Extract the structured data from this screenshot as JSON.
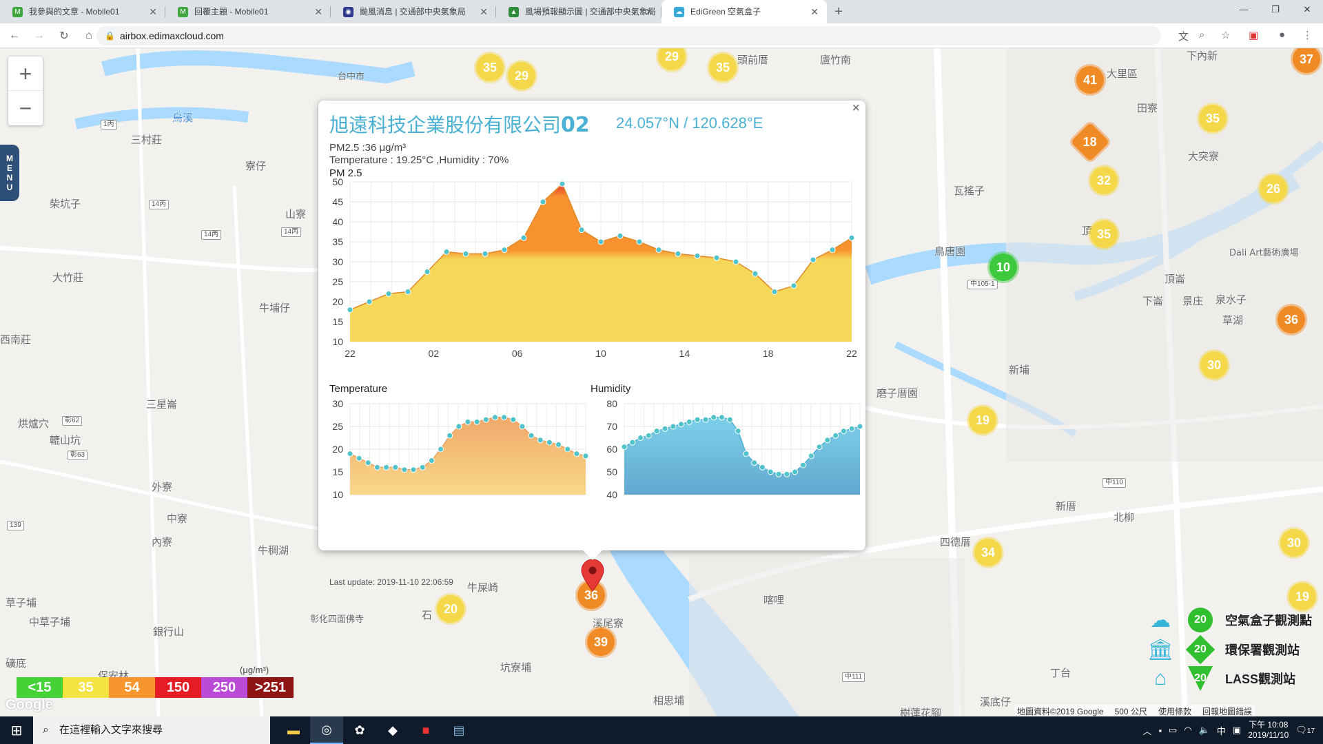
{
  "browser": {
    "tabs": [
      {
        "label": "我參與的文章 - Mobile01",
        "icon": "mobile01-icon",
        "active": false
      },
      {
        "label": "回覆主題 - Mobile01",
        "icon": "mobile01-icon",
        "active": false
      },
      {
        "label": "颱風消息 | 交通部中央氣象局",
        "icon": "cwb-icon",
        "active": false
      },
      {
        "label": "風場預報顯示圖 | 交通部中央氣象局",
        "icon": "cwb-map-icon",
        "active": false
      },
      {
        "label": "EdiGreen 空氣盒子",
        "icon": "edigreen-icon",
        "active": true
      }
    ],
    "url": "airbox.edimaxcloud.com"
  },
  "map": {
    "labels": [
      "三村莊",
      "寮仔",
      "柴坑子",
      "山寮",
      "大竹莊",
      "牛埔仔",
      "西南莊",
      "三星崙",
      "烘爐穴",
      "轆山坑",
      "外寮",
      "中寮",
      "內寮",
      "牛稠湖",
      "草子埔",
      "中草子埔",
      "銀行山",
      "礦底",
      "保安林",
      "牛屎崎",
      "石",
      "坑寮埔",
      "溪尾寮",
      "相思埔",
      "喀哩",
      "瓦搖子",
      "鳥唐園",
      "頂厝子",
      "頂崙",
      "下崙",
      "景庄",
      "泉水子",
      "草湖",
      "新埔",
      "磨子厝園",
      "新厝",
      "北柳",
      "四德厝",
      "丁台",
      "溪底仔",
      "樹蓮花腳",
      "大里區",
      "大突寮",
      "田寮",
      "頭前厝",
      "廬竹南",
      "下內新",
      "台中市",
      "烏溪",
      "彰化四面佛寺",
      "Dali Art藝術廣場"
    ],
    "markers": [
      {
        "value": "35",
        "color": "yellow"
      },
      {
        "value": "29",
        "color": "yellow"
      },
      {
        "value": "29",
        "color": "yellow"
      },
      {
        "value": "35",
        "color": "yellow"
      },
      {
        "value": "41",
        "color": "orange"
      },
      {
        "value": "37",
        "color": "orange"
      },
      {
        "value": "18",
        "color": "orange"
      },
      {
        "value": "35",
        "color": "yellow"
      },
      {
        "value": "32",
        "color": "yellow"
      },
      {
        "value": "26",
        "color": "yellow"
      },
      {
        "value": "35",
        "color": "yellow"
      },
      {
        "value": "10",
        "color": "green"
      },
      {
        "value": "36",
        "color": "orange"
      },
      {
        "value": "30",
        "color": "yellow"
      },
      {
        "value": "19",
        "color": "yellow"
      },
      {
        "value": "34",
        "color": "yellow"
      },
      {
        "value": "30",
        "color": "yellow"
      },
      {
        "value": "19",
        "color": "yellow"
      },
      {
        "value": "20",
        "color": "yellow"
      },
      {
        "value": "36",
        "color": "orange"
      },
      {
        "value": "39",
        "color": "orange"
      }
    ]
  },
  "popup": {
    "title_prefix": "旭遠科技企業股份有限公司",
    "title_num": "02",
    "coords": "24.057°N / 120.628°E",
    "pm25_line": "PM2.5 :36 μg/m³",
    "temp_hum_line": "Temperature : 19.25°C ,Humidity : 70%",
    "pm_chart_title": "PM 2.5",
    "temp_chart_title": "Temperature",
    "hum_chart_title": "Humidity",
    "last_update": "Last update: 2019-11-10 22:06:59",
    "close": "×"
  },
  "chart_data": [
    {
      "type": "area",
      "title": "PM 2.5",
      "x_ticks": [
        "22",
        "02",
        "06",
        "10",
        "14",
        "18",
        "22"
      ],
      "ylim": [
        10,
        50
      ],
      "y_ticks": [
        10,
        15,
        20,
        25,
        30,
        35,
        40,
        45,
        50
      ],
      "values": [
        18,
        20,
        22,
        22.5,
        27.5,
        32.5,
        32,
        32,
        33,
        36,
        45,
        49.5,
        38,
        35,
        36.5,
        35,
        33,
        32,
        31.5,
        31,
        30,
        27,
        22.5,
        24,
        30.5,
        33,
        36
      ],
      "threshold_colors": {
        "low": "#f5d75a",
        "mid": "#f7922e",
        "high": "#e03030"
      }
    },
    {
      "type": "area",
      "title": "Temperature",
      "ylim": [
        10,
        30
      ],
      "y_ticks": [
        10,
        15,
        20,
        25,
        30
      ],
      "values": [
        19,
        18,
        17,
        16,
        16,
        16,
        15.5,
        15.5,
        16,
        17.5,
        20,
        23,
        25,
        26,
        26,
        26.5,
        27,
        27,
        26.5,
        25,
        23,
        22,
        21.5,
        21,
        20,
        19,
        18.5
      ]
    },
    {
      "type": "area",
      "title": "Humidity",
      "ylim": [
        40,
        80
      ],
      "y_ticks": [
        40,
        50,
        60,
        70,
        80
      ],
      "values": [
        61,
        63,
        65,
        66,
        68,
        69,
        70,
        71,
        72,
        73,
        73,
        74,
        74,
        73,
        68,
        58,
        54,
        52,
        50,
        49,
        49,
        50,
        53,
        57,
        61,
        64,
        66,
        68,
        69,
        70
      ]
    }
  ],
  "legend": {
    "aqi_levels": [
      {
        "label": "<15",
        "color": "#44d236"
      },
      {
        "label": "35",
        "color": "#f5e342"
      },
      {
        "label": "54",
        "color": "#f7962d"
      },
      {
        "label": "150",
        "color": "#e51c23"
      },
      {
        "label": "250",
        "color": "#b94bd6"
      },
      {
        "label": ">251",
        "color": "#8f1414"
      }
    ],
    "unit": "(μg/m³)",
    "stations": [
      {
        "label": "空氣盒子觀測點",
        "badge": "20",
        "icon": "airbox-icon"
      },
      {
        "label": "環保署觀測站",
        "badge": "20",
        "icon": "epa-station-icon"
      },
      {
        "label": "LASS觀測站",
        "badge": "20",
        "icon": "lass-station-icon"
      }
    ]
  },
  "attribution": {
    "mapdata": "地圖資料©2019 Google",
    "scale": "500 公尺",
    "terms": "使用條款",
    "report": "回報地圖錯誤",
    "google": "Google"
  },
  "taskbar": {
    "search_placeholder": "在這裡輸入文字來搜尋",
    "time_line1": "下午 10:08",
    "time_line2": "2019/11/10",
    "ime": "中",
    "notif_count": "17"
  }
}
